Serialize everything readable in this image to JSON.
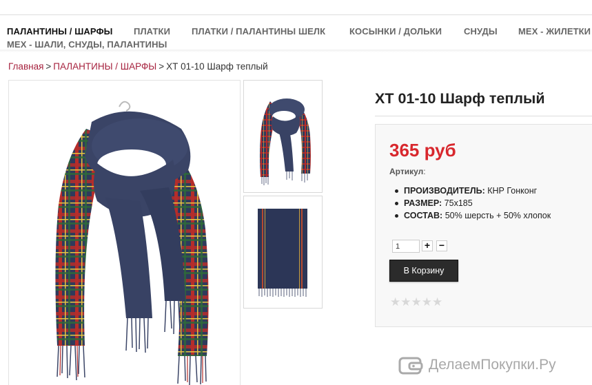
{
  "nav": {
    "items": [
      {
        "label": "ПАЛАНТИНЫ / ШАРФЫ",
        "active": true
      },
      {
        "label": "ПЛАТКИ"
      },
      {
        "label": "ПЛАТКИ / ПАЛАНТИНЫ ШЕЛК"
      },
      {
        "label": "КОСЫНКИ / ДОЛЬКИ"
      },
      {
        "label": "СНУДЫ"
      },
      {
        "label": "МЕХ - ЖИЛЕТКИ"
      },
      {
        "label": "МЕХ - ШАЛИ, СНУДЫ, ПАЛАНТИНЫ"
      }
    ]
  },
  "breadcrumb": {
    "home": "Главная",
    "separator": ">",
    "category": "ПАЛАНТИНЫ / ШАРФЫ",
    "current": "ХТ 01-10 Шарф теплый"
  },
  "product": {
    "title": "ХТ 01-10 Шарф теплый",
    "price": "365 руб",
    "sku_label": "Артикул",
    "sku_suffix": ":",
    "properties": [
      {
        "name": "ПРОИЗВОДИТЕЛЬ:",
        "value": "КНР Гонконг"
      },
      {
        "name": "РАЗМЕР:",
        "value": "75х185"
      },
      {
        "name": "СОСТАВ:",
        "value": "50% шерсть + 50% хлопок"
      }
    ],
    "quantity": "1",
    "plus_label": "+",
    "minus_label": "−",
    "add_to_cart": "В Корзину",
    "rating": 0,
    "rating_max": 5
  },
  "watermark": {
    "text": "ДелаемПокупки.Ру"
  },
  "colors": {
    "accent_red": "#d8272d",
    "link_red": "#a6223e",
    "button_dark": "#2b2b2b",
    "scarf_navy": "#3a4466"
  }
}
